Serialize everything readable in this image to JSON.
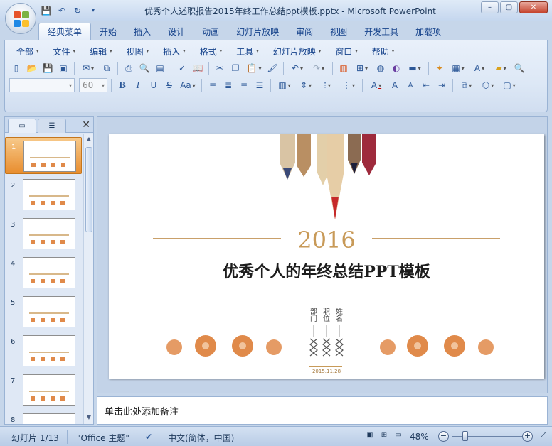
{
  "window": {
    "title": "优秀个人述职报告2015年终工作总结ppt模板.pptx - Microsoft PowerPoint",
    "min_label": "–",
    "max_label": "▢",
    "close_label": "✕"
  },
  "quick_access": [
    {
      "icon": "save-icon",
      "glyph": "💾"
    },
    {
      "icon": "undo-icon",
      "glyph": "↶"
    },
    {
      "icon": "redo-icon",
      "glyph": "↻"
    },
    {
      "icon": "customize-qat-icon",
      "glyph": "▾"
    }
  ],
  "tabs": [
    "经典菜单",
    "开始",
    "插入",
    "设计",
    "动画",
    "幻灯片放映",
    "审阅",
    "视图",
    "开发工具",
    "加载项"
  ],
  "active_tab": "经典菜单",
  "menus": [
    "全部",
    "文件",
    "编辑",
    "视图",
    "插入",
    "格式",
    "工具",
    "幻灯片放映",
    "窗口",
    "帮助"
  ],
  "font": {
    "name_value": "",
    "size_value": "60"
  },
  "toolbar1_icons": [
    "new-icon",
    "open-icon",
    "save-icon",
    "permission-icon",
    "email-icon",
    "publish-icon",
    "print-icon",
    "print-preview-icon",
    "research-icon",
    "spelling-icon",
    "research-book-icon",
    "cut-icon",
    "copy-icon",
    "paste-icon",
    "format-painter-icon",
    "undo-icon",
    "redo-icon",
    "chart-icon",
    "table-icon",
    "clip-art-icon",
    "color-icon",
    "slide-icon",
    "layout-icon",
    "textbox-icon",
    "folder-icon",
    "zoom-icon"
  ],
  "toolbar2_icons": [
    "bold-icon",
    "italic-icon",
    "underline-icon",
    "strikethrough-icon",
    "change-case-icon",
    "align-left-icon",
    "align-center-icon",
    "align-right-icon",
    "justify-icon",
    "columns-icon",
    "line-spacing-icon",
    "bullets-icon",
    "numbering-icon",
    "font-color-icon",
    "increase-font-icon",
    "decrease-font-icon",
    "decrease-indent-icon",
    "increase-indent-icon",
    "arrange-icon",
    "shape-icon",
    "shape-outline-icon"
  ],
  "panel": {
    "slide_numbers": [
      "1",
      "2",
      "3",
      "4",
      "5",
      "6",
      "7",
      "8"
    ],
    "active_index": 0
  },
  "slide": {
    "year": "2016",
    "title": "优秀个人的年终总结PPT模板",
    "fields": [
      "部门",
      "职位",
      "姓名"
    ],
    "date": "2015.11.28"
  },
  "notes_placeholder": "单击此处添加备注",
  "status": {
    "slide_counter": "幻灯片 1/13",
    "theme": "\"Office 主题\"",
    "language": "中文(简体，中国)",
    "zoom": "48%",
    "zoom_fraction": 0.48
  },
  "colors": {
    "accent_gold": "#c89a58",
    "active_thumb": "#e88d2e",
    "ribbon_text": "#15428b"
  }
}
